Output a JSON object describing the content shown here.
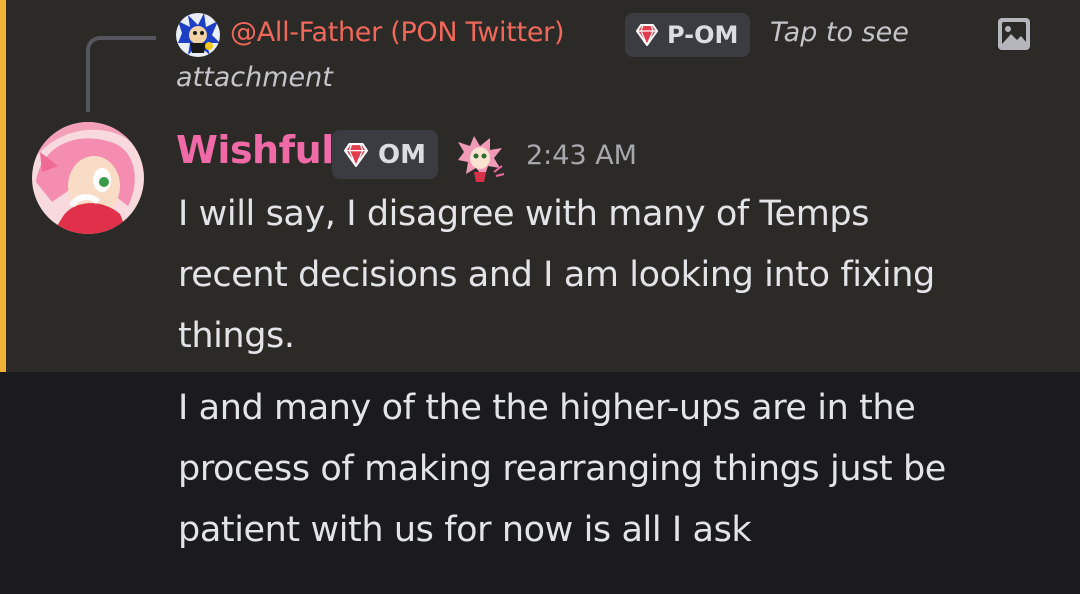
{
  "reply": {
    "author": "@All-Father (PON Twitter)",
    "author_color": "#f0685a",
    "role_label": "P-OM",
    "preview_line1": "Tap to see",
    "preview_line2": "attachment",
    "attachment_icon": "image-icon"
  },
  "message": {
    "author": "Wishful",
    "author_color": "#f06aa7",
    "role_label": "OM",
    "role_icon": "gem-icon",
    "badge_icon": "pink-hedgehog-emoji",
    "timestamp": "2:43 AM",
    "highlight_color": "#f0b232",
    "lines": [
      "I will say, I disagree with many of Temps",
      "recent decisions and I am looking into fixing",
      "things."
    ]
  },
  "followup": {
    "lines": [
      "I and many of the the higher-ups are in the",
      "process of making rearranging things just be",
      "patient with us for now is all I ask"
    ]
  }
}
